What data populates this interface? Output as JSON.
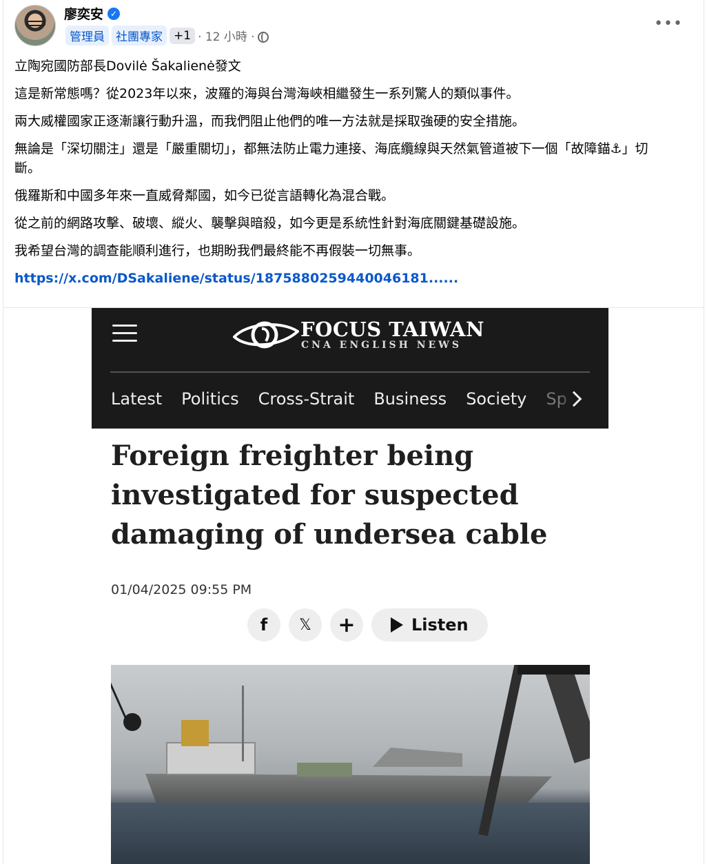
{
  "post": {
    "author": "廖奕安",
    "badges": [
      "管理員",
      "社團專家",
      "+1"
    ],
    "time": "· 12 小時 ·",
    "paragraphs": [
      "立陶宛國防部長Dovilė Šakalienė發文",
      "這是新常態嗎？從2023年以來，波羅的海與台灣海峽相繼發生一系列驚人的類似事件。",
      "兩大威權國家正逐漸讓行動升溫，而我們阻止他們的唯一方法就是採取強硬的安全措施。",
      "無論是「深切關注」還是「嚴重關切」，都無法防止電力連接、海底纜線與天然氣管道被下一個「故障錨⚓」切斷。",
      "俄羅斯和中國多年來一直威脅鄰國，如今已從言語轉化為混合戰。",
      "從之前的網路攻擊、破壞、縱火、襲擊與暗殺，如今更是系統性針對海底關鍵基礎設施。",
      "我希望台灣的調查能順利進行，也期盼我們最終能不再假裝一切無事。"
    ],
    "link": "https://x.com/DSakaliene/status/1875880259440046181......",
    "more_icon": "•••"
  },
  "embed": {
    "site_title": "FOCUS TAIWAN",
    "site_subtitle": "CNA ENGLISH NEWS",
    "nav": [
      "Latest",
      "Politics",
      "Cross-Strait",
      "Business",
      "Society",
      "Sp"
    ],
    "headline": "Foreign freighter being investigated for suspected damaging of undersea cable",
    "date": "01/04/2025 09:55 PM",
    "share": {
      "facebook": "f",
      "x": "𝕏",
      "plus": "+",
      "listen": "Listen"
    }
  },
  "colors": {
    "link": "#0a58ca",
    "badge_bg": "#e7f0fd",
    "header_bg": "#1a1a1a"
  }
}
